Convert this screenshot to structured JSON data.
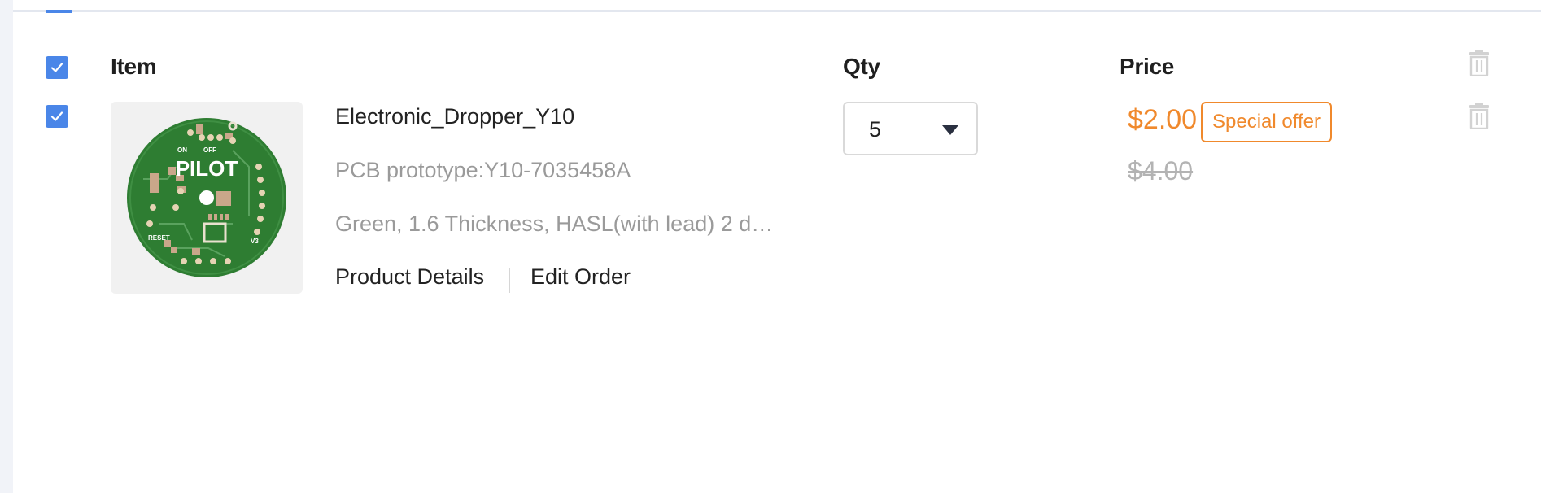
{
  "table": {
    "headers": {
      "item": "Item",
      "qty": "Qty",
      "price": "Price"
    }
  },
  "product": {
    "name": "Electronic_Dropper_Y10",
    "prototype": "PCB prototype:Y10-7035458A",
    "specs": "Green, 1.6 Thickness, HASL(with lead) 2 d…",
    "links": {
      "details": "Product Details",
      "edit": "Edit Order"
    },
    "quantity": "5",
    "price": "$2.00",
    "offer_badge": "Special offer",
    "original_price": "$4.00",
    "thumbnail_text": {
      "brand": "PILOT",
      "on": "ON",
      "off": "OFF",
      "reset": "RESET",
      "version": "V3"
    }
  },
  "colors": {
    "accent": "#4a86e8",
    "offer": "#f0892c",
    "pcb_green": "#2e7d32"
  },
  "icons": [
    "check-icon",
    "trash-icon",
    "chevron-down-icon"
  ]
}
